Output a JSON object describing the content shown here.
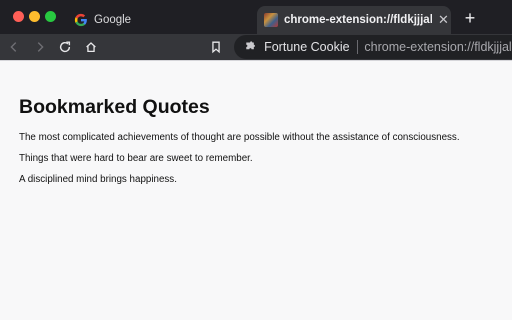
{
  "tabs": [
    {
      "title": "Google",
      "icon": "google-icon"
    },
    {
      "title": "chrome-extension://fldkjjjalojpp",
      "icon": "extension-favicon",
      "active": true
    }
  ],
  "toolbar": {
    "site_name": "Fortune Cookie",
    "url": "chrome-extension://fldkjjjalojpp"
  },
  "page": {
    "title": "Bookmarked Quotes",
    "quotes": [
      "The most complicated achievements of thought are possible without the assistance of consciousness.",
      "Things that were hard to bear are sweet to remember.",
      "A disciplined mind brings happiness."
    ]
  },
  "colors": {
    "tabstrip_bg": "#1f1f24",
    "toolbar_bg": "#35363a",
    "omnibox_bg": "#202124",
    "page_bg": "#f8f8f9"
  }
}
